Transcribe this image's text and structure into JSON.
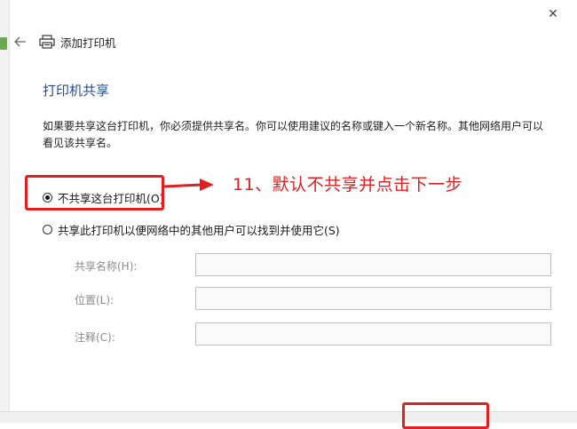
{
  "window": {
    "close_glyph": "✕",
    "title": "添加打印机"
  },
  "section": {
    "title": "打印机共享",
    "description": "如果要共享这台打印机，你必须提供共享名。你可以使用建议的名称或键入一个新名称。其他网络用户可以看见该共享名。"
  },
  "options": [
    {
      "label": "不共享这台打印机(O)",
      "selected": true
    },
    {
      "label": "共享此打印机以便网络中的其他用户可以找到并使用它(S)",
      "selected": false
    }
  ],
  "fields": {
    "share_name": {
      "label": "共享名称(H):",
      "value": ""
    },
    "location": {
      "label": "位置(L):",
      "value": ""
    },
    "comment": {
      "label": "注释(C):",
      "value": ""
    }
  },
  "annotation": {
    "text": "11、默认不共享并点击下一步",
    "color": "#e02020"
  },
  "colors": {
    "section_title": "#1f4e9a",
    "accent_red": "#e02020"
  }
}
